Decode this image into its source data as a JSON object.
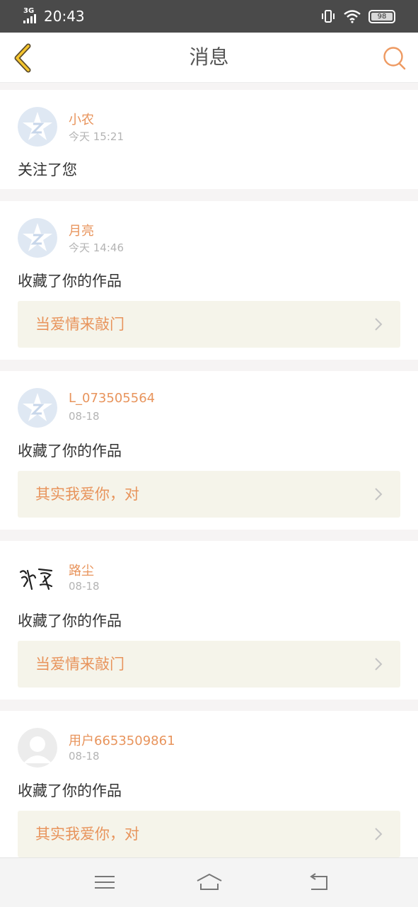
{
  "status_bar": {
    "network": "3G",
    "time": "20:43",
    "battery": "98",
    "icons": [
      "signal-icon",
      "vibrate-icon",
      "wifi-icon",
      "battery-icon"
    ]
  },
  "header": {
    "title": "消息",
    "back_icon": "chevron-left-icon",
    "search_icon": "search-icon"
  },
  "messages": [
    {
      "name": "小农",
      "time": "今天 15:21",
      "action": "关注了您",
      "avatar": "qzone-default-avatar",
      "work_title": null
    },
    {
      "name": "月亮",
      "time": "今天 14:46",
      "action": "收藏了你的作品",
      "avatar": "qzone-default-avatar",
      "work_title": "当爱情来敲门"
    },
    {
      "name": "L_073505564",
      "time": "08-18",
      "action": "收藏了你的作品",
      "avatar": "qzone-default-avatar",
      "work_title": "其实我爱你，对"
    },
    {
      "name": "路尘",
      "time": "08-18",
      "action": "收藏了你的作品",
      "avatar": "calligraphy-avatar",
      "work_title": "当爱情来敲门"
    },
    {
      "name": "用户6653509861",
      "time": "08-18",
      "action": "收藏了你的作品",
      "avatar": "default-user-avatar",
      "work_title": "其实我爱你，对"
    }
  ],
  "nav_bar": {
    "icons": [
      "menu-icon",
      "home-icon",
      "back-icon"
    ]
  },
  "colors": {
    "accent": "#e8945c",
    "link_bg": "#f5f4ea",
    "status_bar": "#4a4a4a",
    "back_arrow": "#f5c52e"
  }
}
